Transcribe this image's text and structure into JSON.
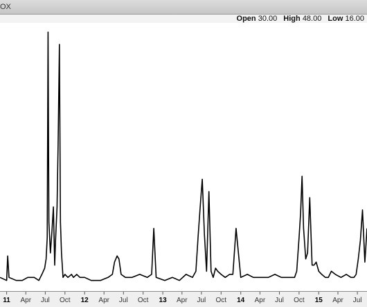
{
  "title": "OX",
  "quote": {
    "open_label": "Open",
    "open_value": "30.00",
    "high_label": "High",
    "high_value": "48.00",
    "low_label": "Low",
    "low_value": "16.00"
  },
  "chart_data": {
    "type": "line",
    "title": "OX",
    "xlabel": "",
    "ylabel": "",
    "grid": false,
    "x_ticks": [
      "11",
      "Apr",
      "Jul",
      "Oct",
      "12",
      "Apr",
      "Jul",
      "Oct",
      "13",
      "Apr",
      "Jul",
      "Oct",
      "14",
      "Apr",
      "Jul",
      "Oct",
      "15",
      "Apr",
      "Jul"
    ],
    "xlim": [
      "2010-12-01",
      "2015-08-15"
    ],
    "ylim": [
      8,
      95
    ],
    "series": [
      {
        "color": "#000000",
        "x": [
          "2010-12-01",
          "2011-01-01",
          "2011-01-06",
          "2011-01-12",
          "2011-02-15",
          "2011-03-15",
          "2011-04-10",
          "2011-05-10",
          "2011-06-01",
          "2011-06-15",
          "2011-06-28",
          "2011-07-05",
          "2011-07-10",
          "2011-07-14",
          "2011-07-18",
          "2011-07-25",
          "2011-08-01",
          "2011-08-08",
          "2011-08-14",
          "2011-08-18",
          "2011-08-25",
          "2011-08-30",
          "2011-09-05",
          "2011-09-10",
          "2011-09-15",
          "2011-09-22",
          "2011-10-01",
          "2011-10-15",
          "2011-11-01",
          "2011-11-10",
          "2011-11-25",
          "2011-12-10",
          "2012-01-01",
          "2012-02-01",
          "2012-03-15",
          "2012-04-20",
          "2012-05-10",
          "2012-05-20",
          "2012-06-01",
          "2012-06-10",
          "2012-06-20",
          "2012-07-10",
          "2012-08-10",
          "2012-09-15",
          "2012-10-20",
          "2012-11-10",
          "2012-11-20",
          "2012-12-01",
          "2013-01-10",
          "2013-02-15",
          "2013-03-20",
          "2013-04-20",
          "2013-05-20",
          "2013-06-05",
          "2013-06-15",
          "2013-06-25",
          "2013-07-05",
          "2013-07-15",
          "2013-07-25",
          "2013-08-05",
          "2013-08-15",
          "2013-08-25",
          "2013-09-05",
          "2013-09-15",
          "2013-10-01",
          "2013-10-20",
          "2013-11-10",
          "2013-11-25",
          "2013-12-10",
          "2014-01-01",
          "2014-02-01",
          "2014-03-01",
          "2014-04-01",
          "2014-05-10",
          "2014-06-10",
          "2014-07-10",
          "2014-08-20",
          "2014-09-10",
          "2014-09-20",
          "2014-10-01",
          "2014-10-08",
          "2014-10-15",
          "2014-10-22",
          "2014-11-01",
          "2014-11-10",
          "2014-11-20",
          "2014-12-01",
          "2014-12-10",
          "2014-12-20",
          "2015-01-01",
          "2015-01-15",
          "2015-02-01",
          "2015-02-15",
          "2015-03-01",
          "2015-03-20",
          "2015-04-15",
          "2015-05-10",
          "2015-06-01",
          "2015-06-15",
          "2015-06-25",
          "2015-07-05",
          "2015-07-15",
          "2015-07-25",
          "2015-08-05",
          "2015-08-15"
        ],
        "y": [
          12,
          11,
          19,
          12,
          11,
          11,
          12,
          12,
          11,
          13,
          15,
          18,
          25,
          92,
          30,
          20,
          27,
          35,
          16,
          24,
          35,
          55,
          88,
          30,
          20,
          12,
          13,
          12,
          13,
          12,
          13,
          12,
          12,
          11,
          11,
          12,
          13,
          17,
          19,
          18,
          13,
          12,
          12,
          13,
          12,
          13,
          28,
          12,
          11,
          12,
          11,
          13,
          12,
          14,
          25,
          35,
          44,
          26,
          14,
          40,
          14,
          12,
          15,
          14,
          13,
          12,
          13,
          13,
          28,
          12,
          13,
          12,
          12,
          12,
          13,
          12,
          12,
          12,
          14,
          25,
          33,
          45,
          28,
          18,
          20,
          38,
          16,
          16,
          17,
          14,
          13,
          12,
          12,
          14,
          13,
          12,
          13,
          12,
          12,
          13,
          18,
          24,
          34,
          17,
          28
        ]
      }
    ]
  }
}
